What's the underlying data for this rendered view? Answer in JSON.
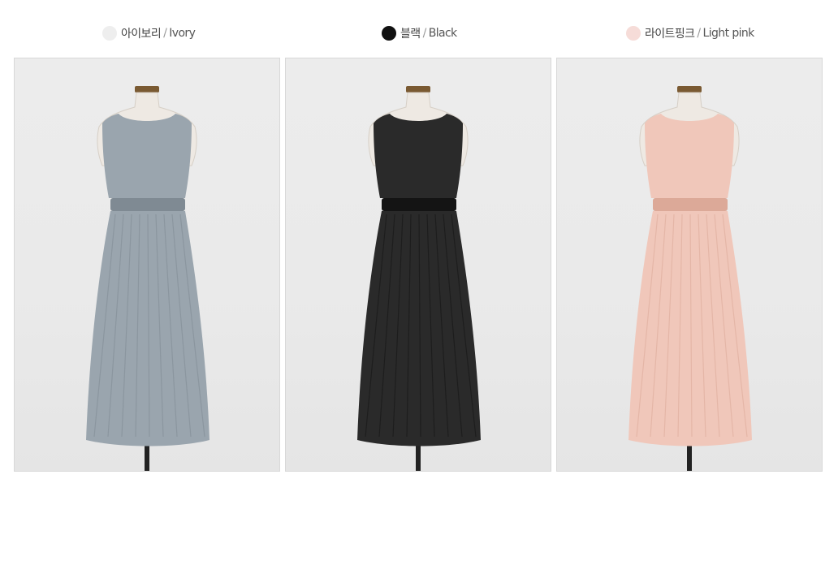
{
  "options": [
    {
      "korean": "아이보리",
      "separator": "/",
      "english": "Ivory",
      "dot_color": "#eeeeee",
      "dress_color": "#9aa5ae",
      "dress_shade": "#7f8a93"
    },
    {
      "korean": "블랙",
      "separator": "/",
      "english": "Black",
      "dot_color": "#111111",
      "dress_color": "#2a2a2a",
      "dress_shade": "#141414"
    },
    {
      "korean": "라이트핑크",
      "separator": "/",
      "english": "Light pink",
      "dot_color": "#f6dcd8",
      "dress_color": "#f0c7ba",
      "dress_shade": "#dca998"
    }
  ]
}
